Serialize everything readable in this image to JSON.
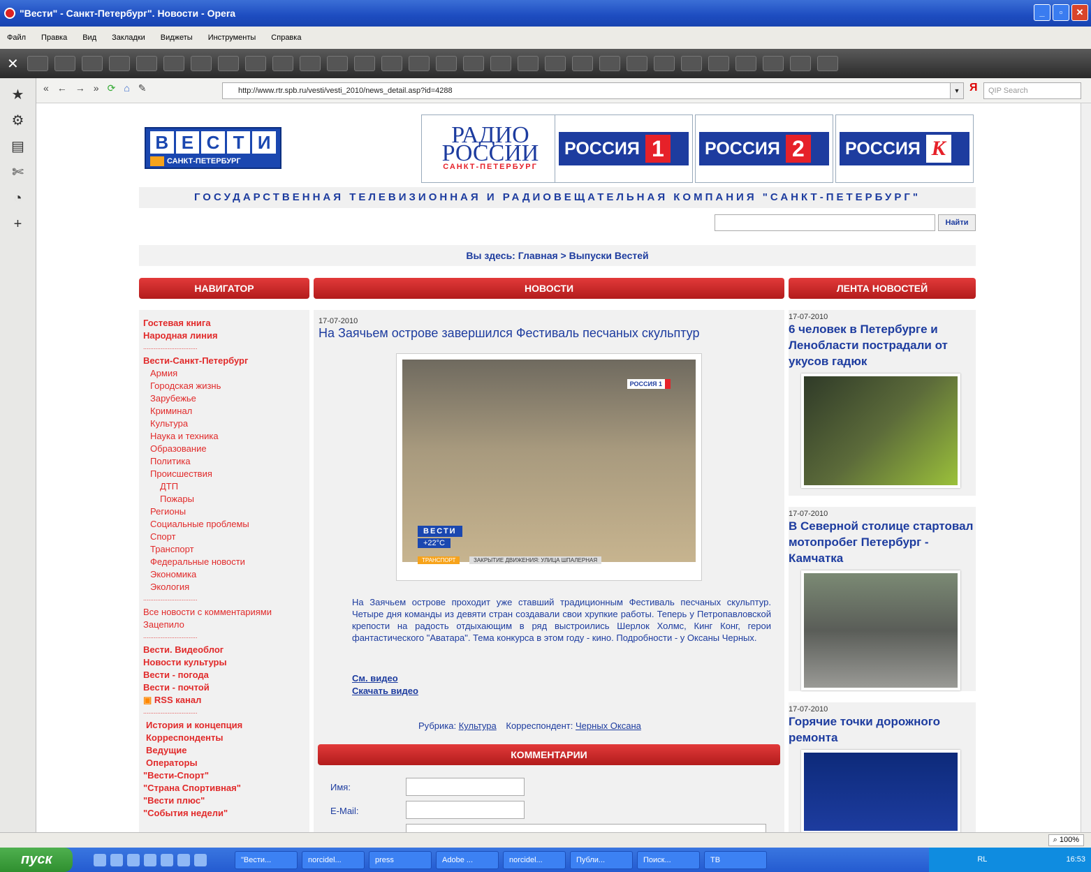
{
  "window": {
    "title": "\"Вести\" - Санкт-Петербург\". Новости - Opera"
  },
  "menu": [
    "Файл",
    "Правка",
    "Вид",
    "Закладки",
    "Виджеты",
    "Инструменты",
    "Справка"
  ],
  "address": {
    "url": "http://www.rtr.spb.ru/vesti/vesti_2010/news_detail.asp?id=4288",
    "search_placeholder": "QIP Search"
  },
  "header": {
    "vesti_letters": [
      "В",
      "Е",
      "С",
      "Т",
      "И"
    ],
    "vesti_city": "САНКТ-ПЕТЕРБУРГ",
    "radio_title": "РАДИО РОССИИ",
    "radio_city": "САНКТ-ПЕТЕРБУРГ",
    "channel_name": "РОССИЯ",
    "channel1": "1",
    "channel2": "2",
    "channelk": "К",
    "company": "ГОСУДАРСТВЕННАЯ ТЕЛЕВИЗИОННАЯ И РАДИОВЕЩАТЕЛЬНАЯ КОМПАНИЯ \"САНКТ-ПЕТЕРБУРГ\"",
    "search_button": "Найти",
    "breadcrumb": "Вы здесь: Главная > Выпуски Вестей"
  },
  "bars": {
    "nav": "НАВИГАТОР",
    "news": "НОВОСТИ",
    "feed": "ЛЕНТА НОВОСТЕЙ",
    "comments": "КОММЕНТАРИИ"
  },
  "nav": {
    "top": [
      "Гостевая книга",
      "Народная линия"
    ],
    "section": "Вести-Санкт-Петербург",
    "cats": [
      "Армия",
      "Городская жизнь",
      "Зарубежье",
      "Криминал",
      "Культура",
      "Наука и техника",
      "Образование",
      "Политика",
      "Происшествия"
    ],
    "sub": [
      "ДТП",
      "Пожары"
    ],
    "cats2": [
      "Регионы",
      "Социальные проблемы",
      "Спорт",
      "Транспорт",
      "Федеральные новости",
      "Экономика",
      "Экология"
    ],
    "more": [
      "Все новости с комментариями",
      "Зацепило"
    ],
    "projects": [
      "Вести. Видеоблог",
      "Новости культуры",
      "Вести - погода",
      "Вести - почтой",
      "RSS канал"
    ],
    "about": [
      "История и концепция",
      "Корреспонденты",
      "Ведущие",
      "Операторы",
      "\"Вести-Спорт\"",
      "\"Страна Спортивная\"",
      "\"Вести плюс\"",
      "\"События недели\""
    ]
  },
  "article": {
    "date": "17-07-2010",
    "title": "На Заячьем острове завершился Фестиваль песчаных скульптур",
    "body": "На Заячьем острове проходит уже ставший традиционным Фестиваль песчаных скульптур. Четыре дня команды из девяти стран создавали свои хрупкие работы. Теперь у Петропавловской крепости на радость отдыхающим в ряд выстроились Шерлок Холмс, Кинг Конг, герои фантастического \"Аватара\". Тема конкурса в этом году - кино. Подробности - у Оксаны Черных.",
    "watch": "См. видео",
    "download": "Скачать видео",
    "rubric_label": "Рубрика:",
    "rubric": "Культура",
    "corr_label": "Корреспондент:",
    "corr": "Черных Оксана",
    "photo_badge": "РОССИЯ 1",
    "photo_logo": "ВЕСТИ",
    "photo_temp": "+22°С",
    "photo_strip": "ЗАКРЫТИЕ ДВИЖЕНИЯ: УЛИЦА ШПАЛЕРНАЯ",
    "photo_tag": "ТРАНСПОРТ"
  },
  "form": {
    "name_label": "Имя:",
    "email_label": "E-Mail:"
  },
  "feed": [
    {
      "date": "17-07-2010",
      "title": "6 человек в Петербурге и Ленобласти пострадали от укусов гадюк"
    },
    {
      "date": "17-07-2010",
      "title": "В Северной столице стартовал мотопробег Петербург - Камчатка"
    },
    {
      "date": "17-07-2010",
      "title": "Горячие точки дорожного ремонта"
    }
  ],
  "status": {
    "zoom": "100%"
  },
  "taskbar": {
    "start": "пуск",
    "tasks": [
      "\"Вести...",
      "norcidel...",
      "press",
      "Adobe ...",
      "norcidel...",
      "Публи...",
      "Поиск...",
      "TB"
    ],
    "time": "16:53",
    "lang": "RL"
  }
}
